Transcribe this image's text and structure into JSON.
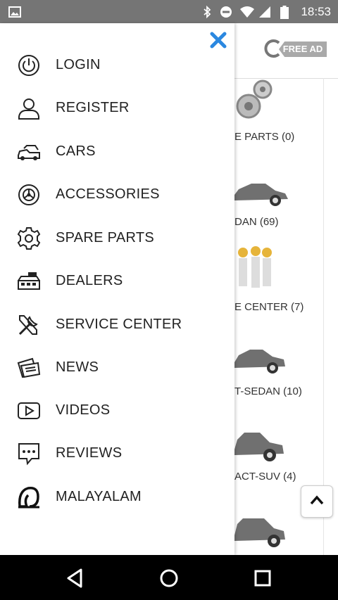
{
  "status_bar": {
    "time": "18:53",
    "icons": [
      "image-icon",
      "bluetooth-icon",
      "dnd-icon",
      "wifi-icon",
      "signal-icon",
      "battery-icon"
    ]
  },
  "header": {
    "free_ad_label": "FREE AD"
  },
  "drawer": {
    "menu": [
      {
        "label": "LOGIN",
        "icon": "power-icon"
      },
      {
        "label": "REGISTER",
        "icon": "user-icon"
      },
      {
        "label": "CARS",
        "icon": "cars-icon"
      },
      {
        "label": "ACCESSORIES",
        "icon": "steering-wheel-icon"
      },
      {
        "label": "SPARE PARTS",
        "icon": "gear-icon"
      },
      {
        "label": "DEALERS",
        "icon": "dealer-store-icon"
      },
      {
        "label": "SERVICE CENTER",
        "icon": "tools-icon"
      },
      {
        "label": "NEWS",
        "icon": "news-icon"
      },
      {
        "label": "VIDEOS",
        "icon": "video-play-icon"
      },
      {
        "label": "REVIEWS",
        "icon": "chat-bubble-icon"
      },
      {
        "label": "MALAYALAM",
        "icon": "malayalam-letter-icon"
      }
    ]
  },
  "categories": [
    {
      "label": "E PARTS (0)"
    },
    {
      "label": "DAN (69)"
    },
    {
      "label": "E CENTER (7)"
    },
    {
      "label": "T-SEDAN (10)"
    },
    {
      "label": "ACT-SUV (4)"
    }
  ],
  "colors": {
    "status_bar": "#757575",
    "accent_close": "#2b88e0",
    "nav_bar": "#000000",
    "free_ad_tag": "#a9a9a9"
  }
}
